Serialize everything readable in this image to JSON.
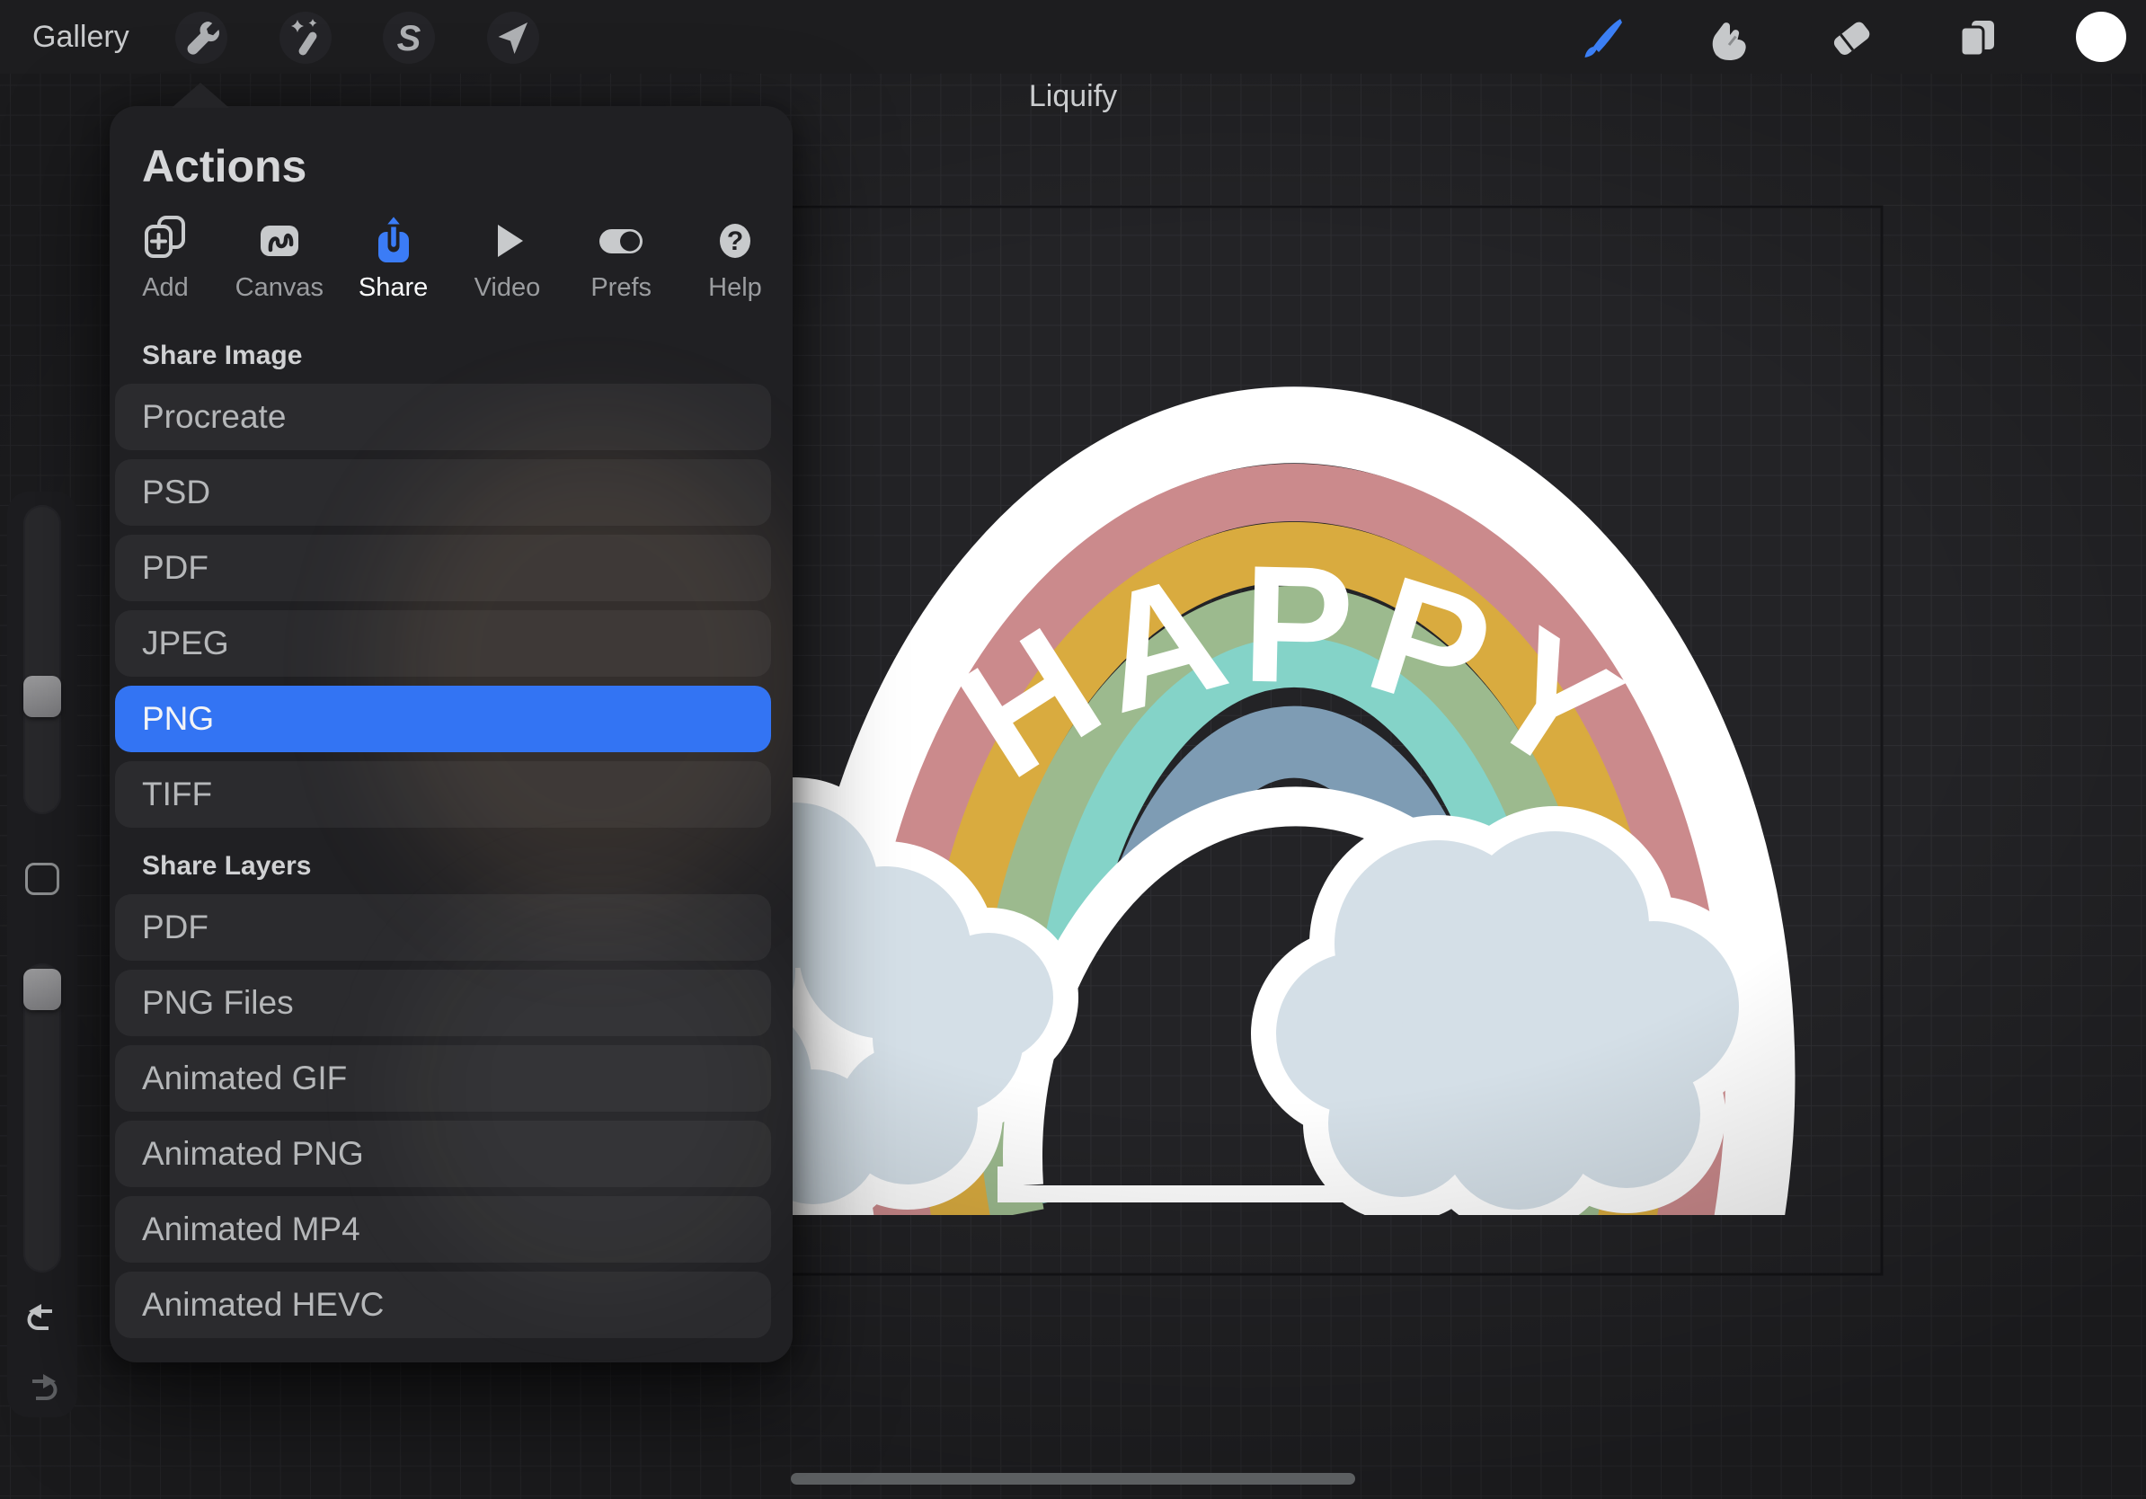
{
  "topbar": {
    "gallery_label": "Gallery",
    "status_label": "Liquify",
    "left_tools": [
      "wrench",
      "magic-wand",
      "adjustments-s",
      "transform-arrow"
    ],
    "right_tools": [
      "brush",
      "smudge",
      "eraser",
      "layers",
      "color-swatch"
    ],
    "accent_color": "#3b7ff5"
  },
  "panel": {
    "title": "Actions",
    "tabs": [
      {
        "label": "Add",
        "icon": "add-icon",
        "selected": false
      },
      {
        "label": "Canvas",
        "icon": "canvas-icon",
        "selected": false
      },
      {
        "label": "Share",
        "icon": "share-icon",
        "selected": true
      },
      {
        "label": "Video",
        "icon": "video-icon",
        "selected": false
      },
      {
        "label": "Prefs",
        "icon": "prefs-icon",
        "selected": false
      },
      {
        "label": "Help",
        "icon": "help-icon",
        "selected": false
      }
    ],
    "share_image": {
      "header": "Share Image",
      "items": [
        "Procreate",
        "PSD",
        "PDF",
        "JPEG",
        "PNG",
        "TIFF"
      ],
      "selected": "PNG"
    },
    "share_layers": {
      "header": "Share Layers",
      "items": [
        "PDF",
        "PNG Files",
        "Animated GIF",
        "Animated PNG",
        "Animated MP4",
        "Animated HEVC"
      ]
    },
    "selection_color": "#3374f3"
  },
  "canvas": {
    "sticker_text": "HAPPY",
    "rainbow_colors": {
      "outline": "#ffffff",
      "pink": "#cb8a8c",
      "yellow": "#d9ab3f",
      "green": "#9cba8e",
      "teal": "#84d3c8",
      "blue": "#7e9cb4"
    },
    "cloud_color": "#d4dfe7",
    "background": "#232326",
    "grid_line": "#2e2e32"
  },
  "sidebar": {
    "controls": [
      "brush-size-slider",
      "modify-button",
      "opacity-slider",
      "undo",
      "redo"
    ]
  }
}
